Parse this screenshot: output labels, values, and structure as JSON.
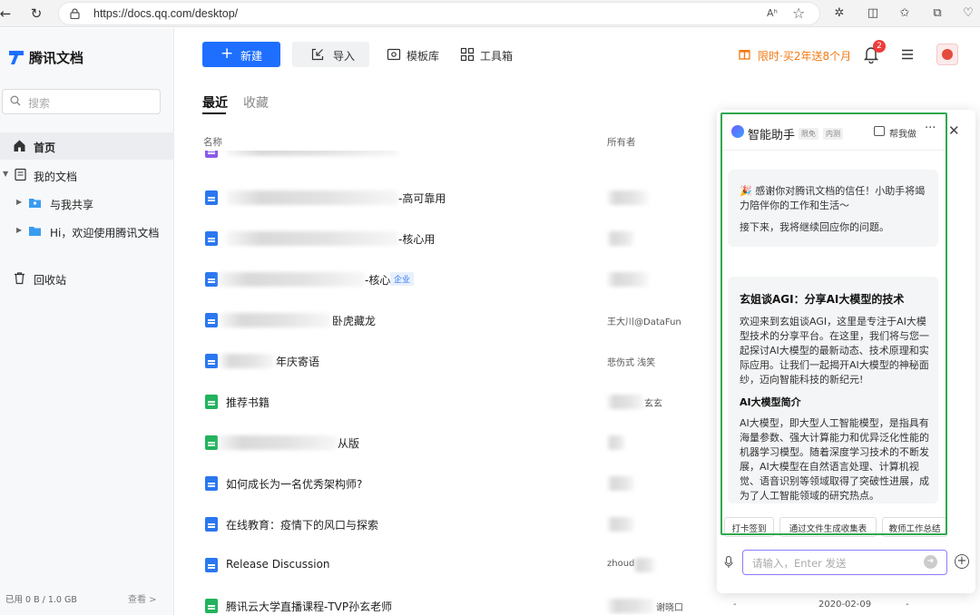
{
  "browser": {
    "url": "https://docs.qq.com/desktop/",
    "read_aloud": "Aʰ",
    "icons": [
      "back-icon",
      "reload-icon",
      "lock-icon",
      "read-aloud-icon",
      "favorite-star-icon",
      "extensions-icon",
      "split-screen-icon",
      "favorites-icon",
      "collections-icon",
      "copilot-icon"
    ]
  },
  "sidebar": {
    "brand": "腾讯文档",
    "search_placeholder": "搜索",
    "items": [
      {
        "label": "首页",
        "active": true
      },
      {
        "label": "我的文档"
      },
      {
        "label": "与我共享"
      },
      {
        "label": "Hi，欢迎使用腾讯文档"
      },
      {
        "label": "回收站"
      }
    ],
    "usage": "已用 0 B / 1.0 GB",
    "usage_more": "查看 >"
  },
  "toolbar": {
    "new_label": "新建",
    "import_label": "导入",
    "templates_label": "模板库",
    "tools_label": "工具箱",
    "promo": "限时·买2年送8个月",
    "notifications": "2",
    "accent": "#1e6fff",
    "promo_color": "#f07a14"
  },
  "tabs": {
    "recent": "最近",
    "favorites": "收藏"
  },
  "columns": {
    "name": "名称",
    "owner": "所有者"
  },
  "files": [
    {
      "name": "-高可靠用",
      "owner": "",
      "type": "doc"
    },
    {
      "name": "-核心用",
      "owner": "",
      "type": "doc"
    },
    {
      "name": "-核心",
      "tag": "企业",
      "owner": "",
      "type": "doc"
    },
    {
      "name": "卧虎藏龙",
      "owner": "王大川@DataFun",
      "type": "doc"
    },
    {
      "name": "年庆寄语",
      "owner": "悲伤式 浅笑",
      "type": "doc"
    },
    {
      "name": "推荐书籍",
      "owner": "玄玄",
      "type": "sheet"
    },
    {
      "name": "从版",
      "owner": "",
      "type": "sheet"
    },
    {
      "name": "如何成长为一名优秀架构师?",
      "owner": "",
      "type": "doc"
    },
    {
      "name": "在线教育：疫情下的风口与探索",
      "owner": "",
      "type": "doc"
    },
    {
      "name": "Release Discussion",
      "owner": "zhoud",
      "type": "doc"
    },
    {
      "name": "腾讯云大学直播课程-TVP孙玄老师",
      "owner": "谢晓口",
      "dash": "-",
      "date": "2020-02-09",
      "dash2": "-",
      "type": "sheet"
    }
  ],
  "assistant": {
    "title": "智能助手",
    "tag1": "限免",
    "tag2": "内测",
    "help": "帮我做",
    "more": "···",
    "greeting": "🎉 感谢你对腾讯文档的信任！小助手将竭力陪伴你的工作和生活～",
    "followup": "接下来，我将继续回应你的问题。",
    "article_title": "玄姐谈AGI：分享AI大模型的技术",
    "article_intro": "欢迎来到玄姐谈AGI，这里是专注于AI大模型技术的分享平台。在这里，我们将与您一起探讨AI大模型的最新动态、技术原理和实际应用。让我们一起揭开AI大模型的神秘面纱，迈向智能科技的新纪元!",
    "section_title": "AI大模型简介",
    "section_body": "AI大模型，即大型人工智能模型，是指具有海量参数、强大计算能力和优异泛化性能的机器学习模型。随着深度学习技术的不断发展，AI大模型在自然语言处理、计算机视觉、语音识别等领域取得了突破性进展，成为了人工智能领域的研究热点。",
    "chips": [
      "打卡签到",
      "通过文件生成收集表",
      "教师工作总结"
    ],
    "input_placeholder": "请输入，Enter 发送",
    "highlight_color": "#2fa84f"
  }
}
